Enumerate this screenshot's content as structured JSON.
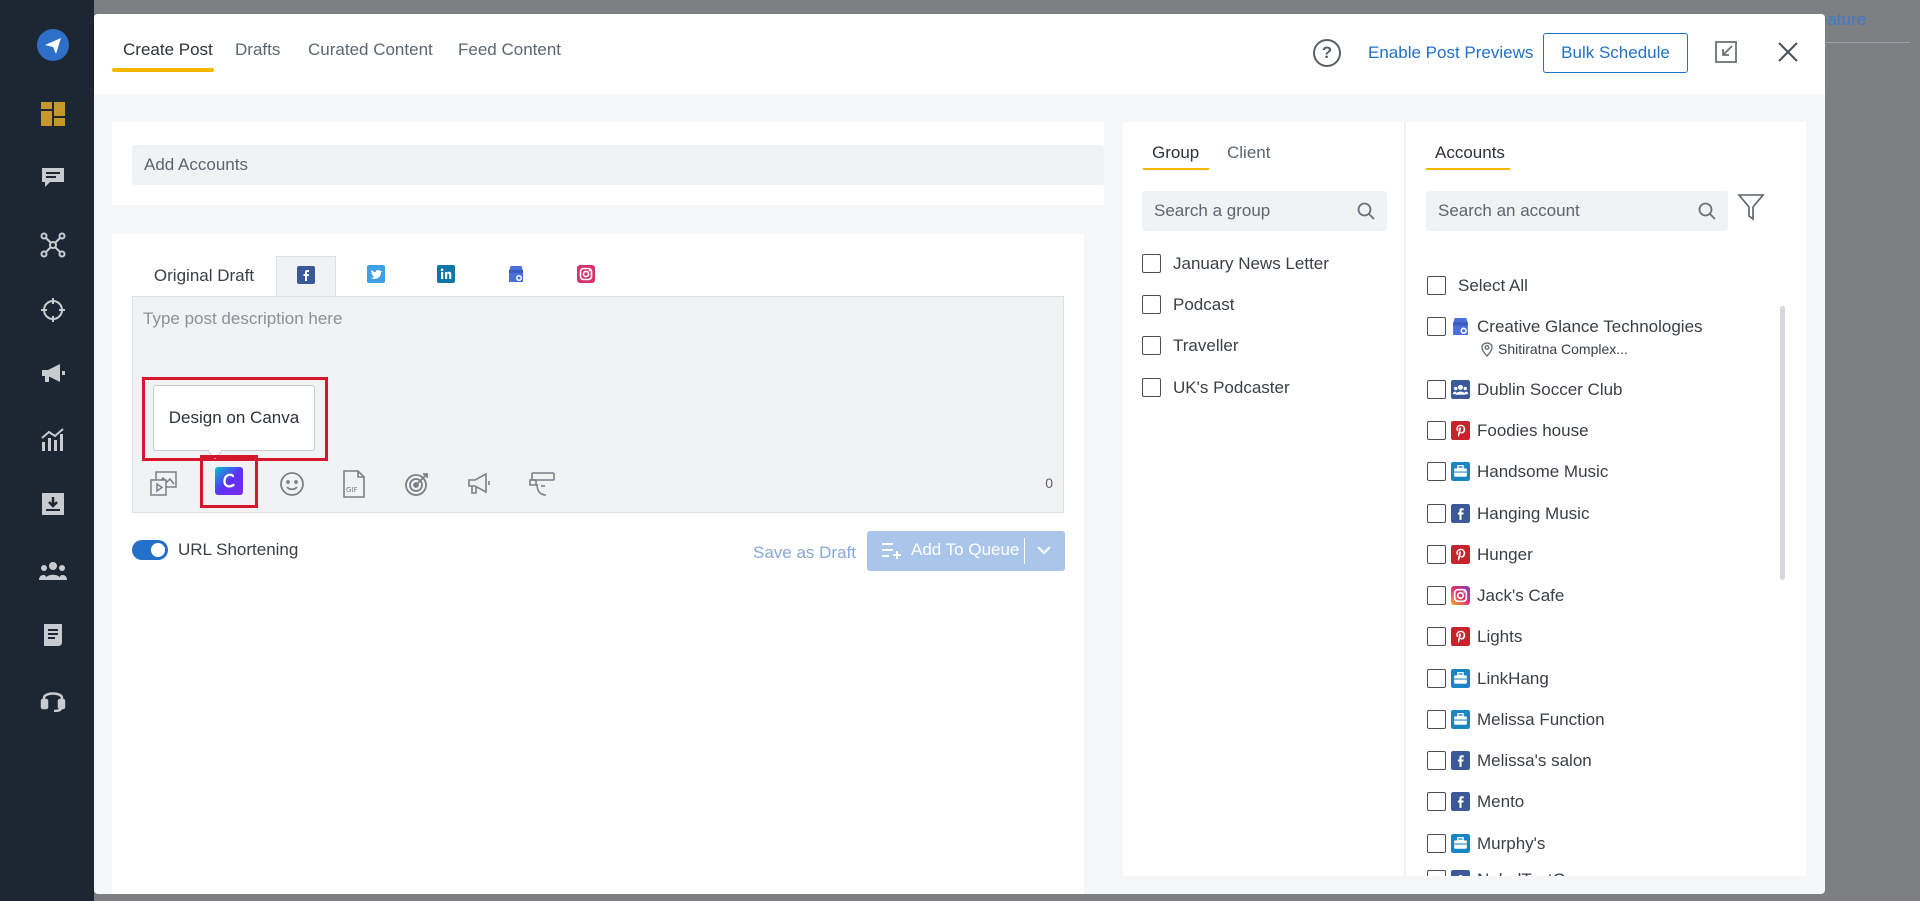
{
  "background": {
    "feature_text": "eature"
  },
  "sidebar": {
    "icons": [
      "send-logo-icon",
      "dashboard-icon",
      "chat-icon",
      "network-icon",
      "target-icon",
      "megaphone-icon",
      "analytics-icon",
      "inbox-download-icon",
      "team-icon",
      "reports-icon",
      "support-headset-icon"
    ]
  },
  "header": {
    "tabs": [
      "Create Post",
      "Drafts",
      "Curated Content",
      "Feed Content"
    ],
    "active_tab": "Create Post",
    "help_icon": "?",
    "enable_previews": "Enable Post Previews",
    "bulk_schedule": "Bulk Schedule"
  },
  "composer": {
    "add_accounts_placeholder": "Add Accounts",
    "network_tabs": [
      "Original Draft",
      "facebook",
      "twitter",
      "linkedin",
      "google-business",
      "instagram"
    ],
    "active_network": "facebook",
    "description_placeholder": "Type post description here",
    "tooltip": "Design on Canva",
    "tools": [
      "media-icon",
      "canva-icon",
      "emoji-icon",
      "gif-icon",
      "target-icon",
      "megaphone-icon",
      "hashtag-icon"
    ],
    "char_count": "0",
    "url_shortening": {
      "label": "URL Shortening",
      "on": true
    },
    "save_as_draft": "Save as Draft",
    "add_to_queue": "Add To Queue"
  },
  "group_panel": {
    "tabs": [
      "Group",
      "Client"
    ],
    "active_tab": "Group",
    "search_placeholder": "Search a group",
    "groups": [
      "January News Letter",
      "Podcast",
      "Traveller",
      "UK's Podcaster"
    ]
  },
  "accounts_panel": {
    "tab": "Accounts",
    "search_placeholder": "Search an account",
    "select_all": "Select All",
    "accounts": [
      {
        "name": "Creative Glance Technologies",
        "network": "google-business",
        "sub": "Shitiratna Complex..."
      },
      {
        "name": "Dublin Soccer Club",
        "network": "facebook-group"
      },
      {
        "name": "Foodies house",
        "network": "pinterest"
      },
      {
        "name": "Handsome Music",
        "network": "linkedin-company"
      },
      {
        "name": "Hanging Music",
        "network": "facebook"
      },
      {
        "name": "Hunger",
        "network": "pinterest"
      },
      {
        "name": "Jack's Cafe",
        "network": "instagram"
      },
      {
        "name": "Lights",
        "network": "pinterest"
      },
      {
        "name": "LinkHang",
        "network": "linkedin-company"
      },
      {
        "name": "Melissa Function",
        "network": "linkedin-company"
      },
      {
        "name": "Melissa's salon",
        "network": "facebook"
      },
      {
        "name": "Mento",
        "network": "facebook"
      },
      {
        "name": "Murphy's",
        "network": "linkedin-company"
      },
      {
        "name": "NehalTestGroup",
        "network": "facebook-group"
      }
    ]
  },
  "colors": {
    "accent": "#2370c8",
    "tab_underline": "#f5b800",
    "highlight_box": "#d6162d",
    "sidebar": "#1d2733"
  }
}
